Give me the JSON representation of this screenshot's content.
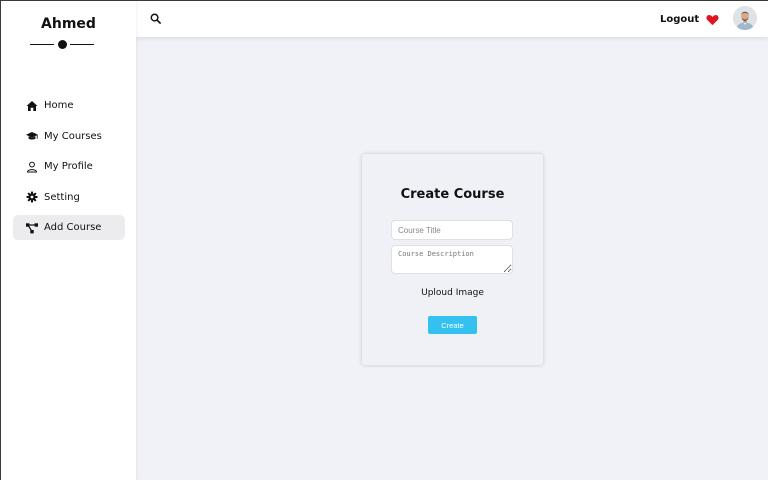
{
  "sidebar": {
    "brand": "Ahmed",
    "items": [
      {
        "label": "Home",
        "icon": "home-icon",
        "active": false
      },
      {
        "label": "My Courses",
        "icon": "graduation-cap-icon",
        "active": false
      },
      {
        "label": "My Profile",
        "icon": "user-icon",
        "active": false
      },
      {
        "label": "Setting",
        "icon": "gear-icon",
        "active": false
      },
      {
        "label": "Add Course",
        "icon": "network-icon",
        "active": true
      }
    ]
  },
  "topbar": {
    "search_icon": "search-icon",
    "logout_label": "Logout",
    "heart_icon": "heart-icon",
    "heart_color": "#e0141e",
    "avatar": "avatar"
  },
  "form": {
    "title": "Create Course",
    "course_title_placeholder": "Course Title",
    "course_title_value": "",
    "course_description_placeholder": "Course Description",
    "course_description_value": "",
    "upload_label": "Uploud Image",
    "create_label": "Create",
    "accent_color": "#35c1ef"
  }
}
